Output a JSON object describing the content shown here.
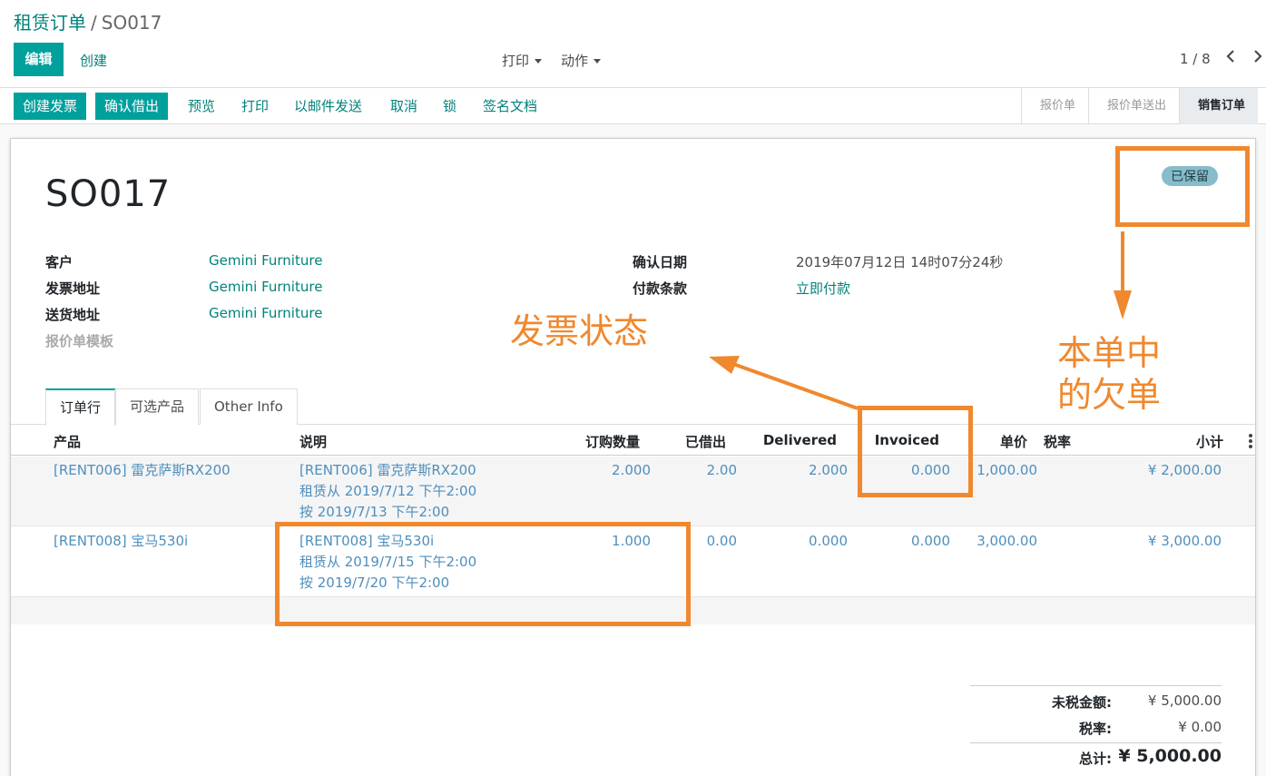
{
  "breadcrumb": {
    "parent": "租赁订单",
    "separator": "/",
    "current": "SO017"
  },
  "toolbar": {
    "edit_label": "编辑",
    "create_label": "创建",
    "print_label": "打印",
    "action_label": "动作"
  },
  "pager": {
    "value": "1 / 8"
  },
  "statusbar": {
    "buttons": [
      "创建发票",
      "确认借出",
      "预览",
      "打印",
      "以邮件发送",
      "取消",
      "锁",
      "签名文档"
    ],
    "stages": [
      "报价单",
      "报价单送出",
      "销售订单"
    ],
    "active_stage": "销售订单"
  },
  "form": {
    "name": "SO017",
    "status_badge": "已保留",
    "fields_left": [
      {
        "label": "客户",
        "value": "Gemini Furniture"
      },
      {
        "label": "发票地址",
        "value": "Gemini Furniture"
      },
      {
        "label": "送货地址",
        "value": "Gemini Furniture"
      },
      {
        "label": "报价单模板",
        "value": ""
      }
    ],
    "fields_right": [
      {
        "label": "确认日期",
        "value": "2019年07月12日 14时07分24秒"
      },
      {
        "label": "付款条款",
        "value": "立即付款"
      }
    ]
  },
  "tabs": [
    "订单行",
    "可选产品",
    "Other Info"
  ],
  "table": {
    "headers": [
      "产品",
      "说明",
      "订购数量",
      "已借出",
      "Delivered",
      "Invoiced",
      "单价",
      "税率",
      "小计"
    ],
    "rows": [
      {
        "product": "[RENT006] 雷克萨斯RX200",
        "desc": [
          "[RENT006] 雷克萨斯RX200",
          "租赁从 2019/7/12 下午2:00",
          "按 2019/7/13 下午2:00"
        ],
        "qty": "2.000",
        "lent": "2.00",
        "delivered": "2.000",
        "invoiced": "0.000",
        "price": "1,000.00",
        "tax": "",
        "subtotal": "¥ 2,000.00"
      },
      {
        "product": "[RENT008] 宝马530i",
        "desc": [
          "[RENT008] 宝马530i",
          "租赁从 2019/7/15 下午2:00",
          "按 2019/7/20 下午2:00"
        ],
        "qty": "1.000",
        "lent": "0.00",
        "delivered": "0.000",
        "invoiced": "0.000",
        "price": "3,000.00",
        "tax": "",
        "subtotal": "¥ 3,000.00"
      }
    ]
  },
  "totals": {
    "untaxed_label": "未税金额:",
    "untaxed_value": "¥ 5,000.00",
    "tax_label": "税率:",
    "tax_value": "¥ 0.00",
    "total_label": "总计:",
    "total_value": "¥ 5,000.00"
  },
  "annotations": {
    "invoice_status": "发票状态",
    "backorder_line1": "本单中",
    "backorder_line2": "的欠单",
    "color": "#f0882e"
  },
  "colors": {
    "primary": "#00a09d",
    "link": "#00827a",
    "row_text": "#4e8fbd",
    "badge": "#87bccb"
  }
}
